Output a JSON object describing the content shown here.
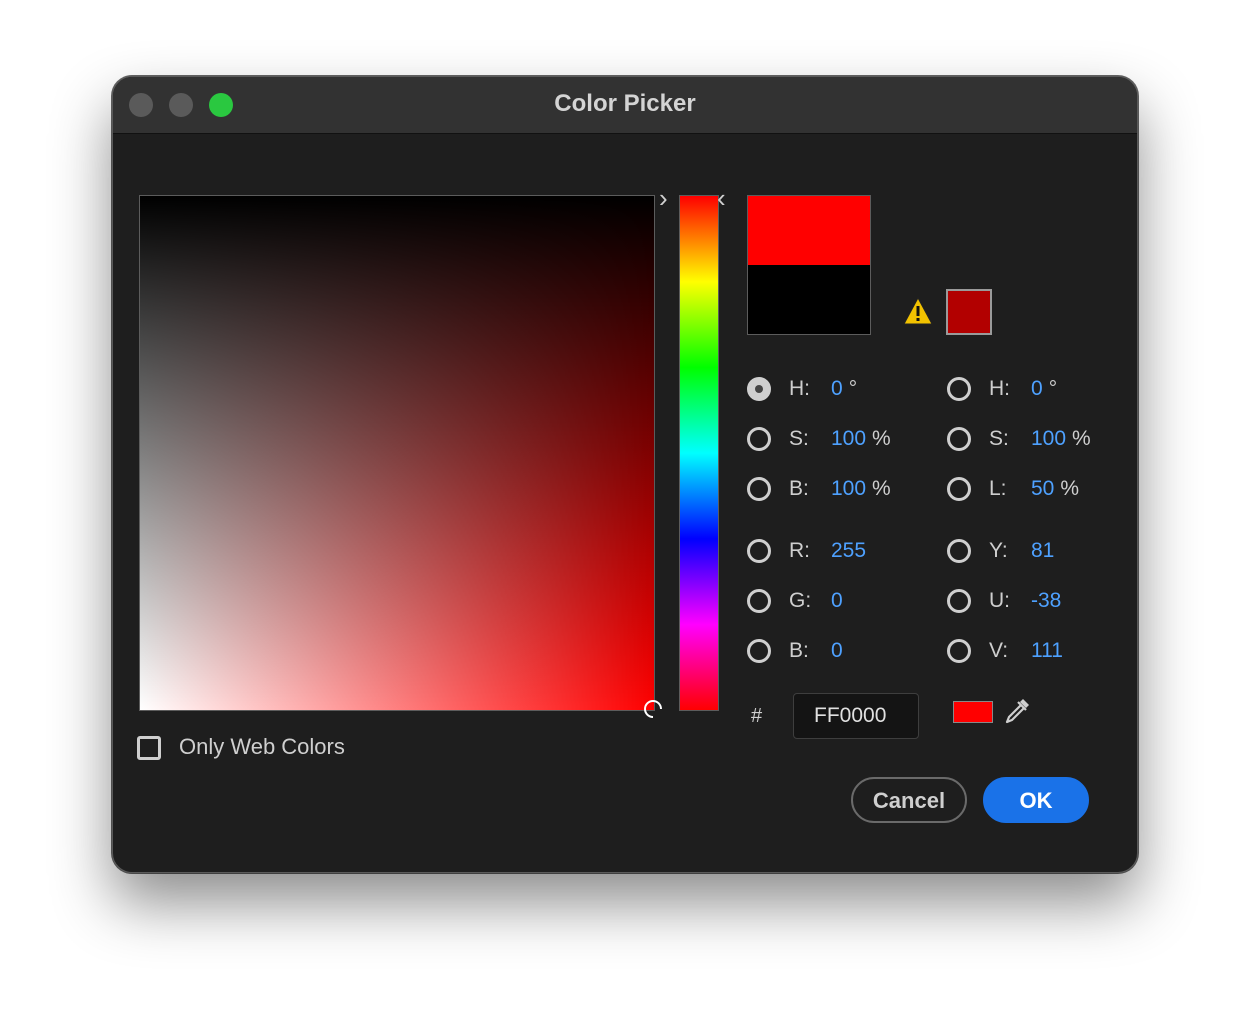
{
  "window": {
    "title": "Color Picker"
  },
  "picker": {
    "current_color": "#ff0000",
    "previous_color": "#000000",
    "gamut_color": "#b20000",
    "hue_gradient": [
      "#ff0000",
      "#ffff00",
      "#00ff00",
      "#00ffff",
      "#0000ff",
      "#ff00ff",
      "#ff0000"
    ]
  },
  "hsb": [
    {
      "label": "H:",
      "value": "0",
      "unit": "°",
      "checked": true
    },
    {
      "label": "S:",
      "value": "100",
      "unit": "%",
      "checked": false
    },
    {
      "label": "B:",
      "value": "100",
      "unit": "%",
      "checked": false
    }
  ],
  "hsl": [
    {
      "label": "H:",
      "value": "0",
      "unit": "°",
      "checked": false
    },
    {
      "label": "S:",
      "value": "100",
      "unit": "%",
      "checked": false
    },
    {
      "label": "L:",
      "value": "50",
      "unit": "%",
      "checked": false
    }
  ],
  "rgb": [
    {
      "label": "R:",
      "value": "255",
      "checked": false
    },
    {
      "label": "G:",
      "value": "0",
      "checked": false
    },
    {
      "label": "B:",
      "value": "0",
      "checked": false
    }
  ],
  "yuv": [
    {
      "label": "Y:",
      "value": "81",
      "checked": false
    },
    {
      "label": "U:",
      "value": "-38",
      "checked": false
    },
    {
      "label": "V:",
      "value": "111",
      "checked": false
    }
  ],
  "hex": {
    "prefix": "#",
    "value": "FF0000"
  },
  "options": {
    "only_web_colors_label": "Only Web Colors",
    "only_web_colors_checked": false
  },
  "buttons": {
    "cancel": "Cancel",
    "ok": "OK"
  },
  "icons": {
    "warning": "warning-triangle-icon",
    "eyedropper": "eyedropper-icon",
    "hue_left": "chevron-right-icon",
    "hue_right": "chevron-left-icon"
  }
}
